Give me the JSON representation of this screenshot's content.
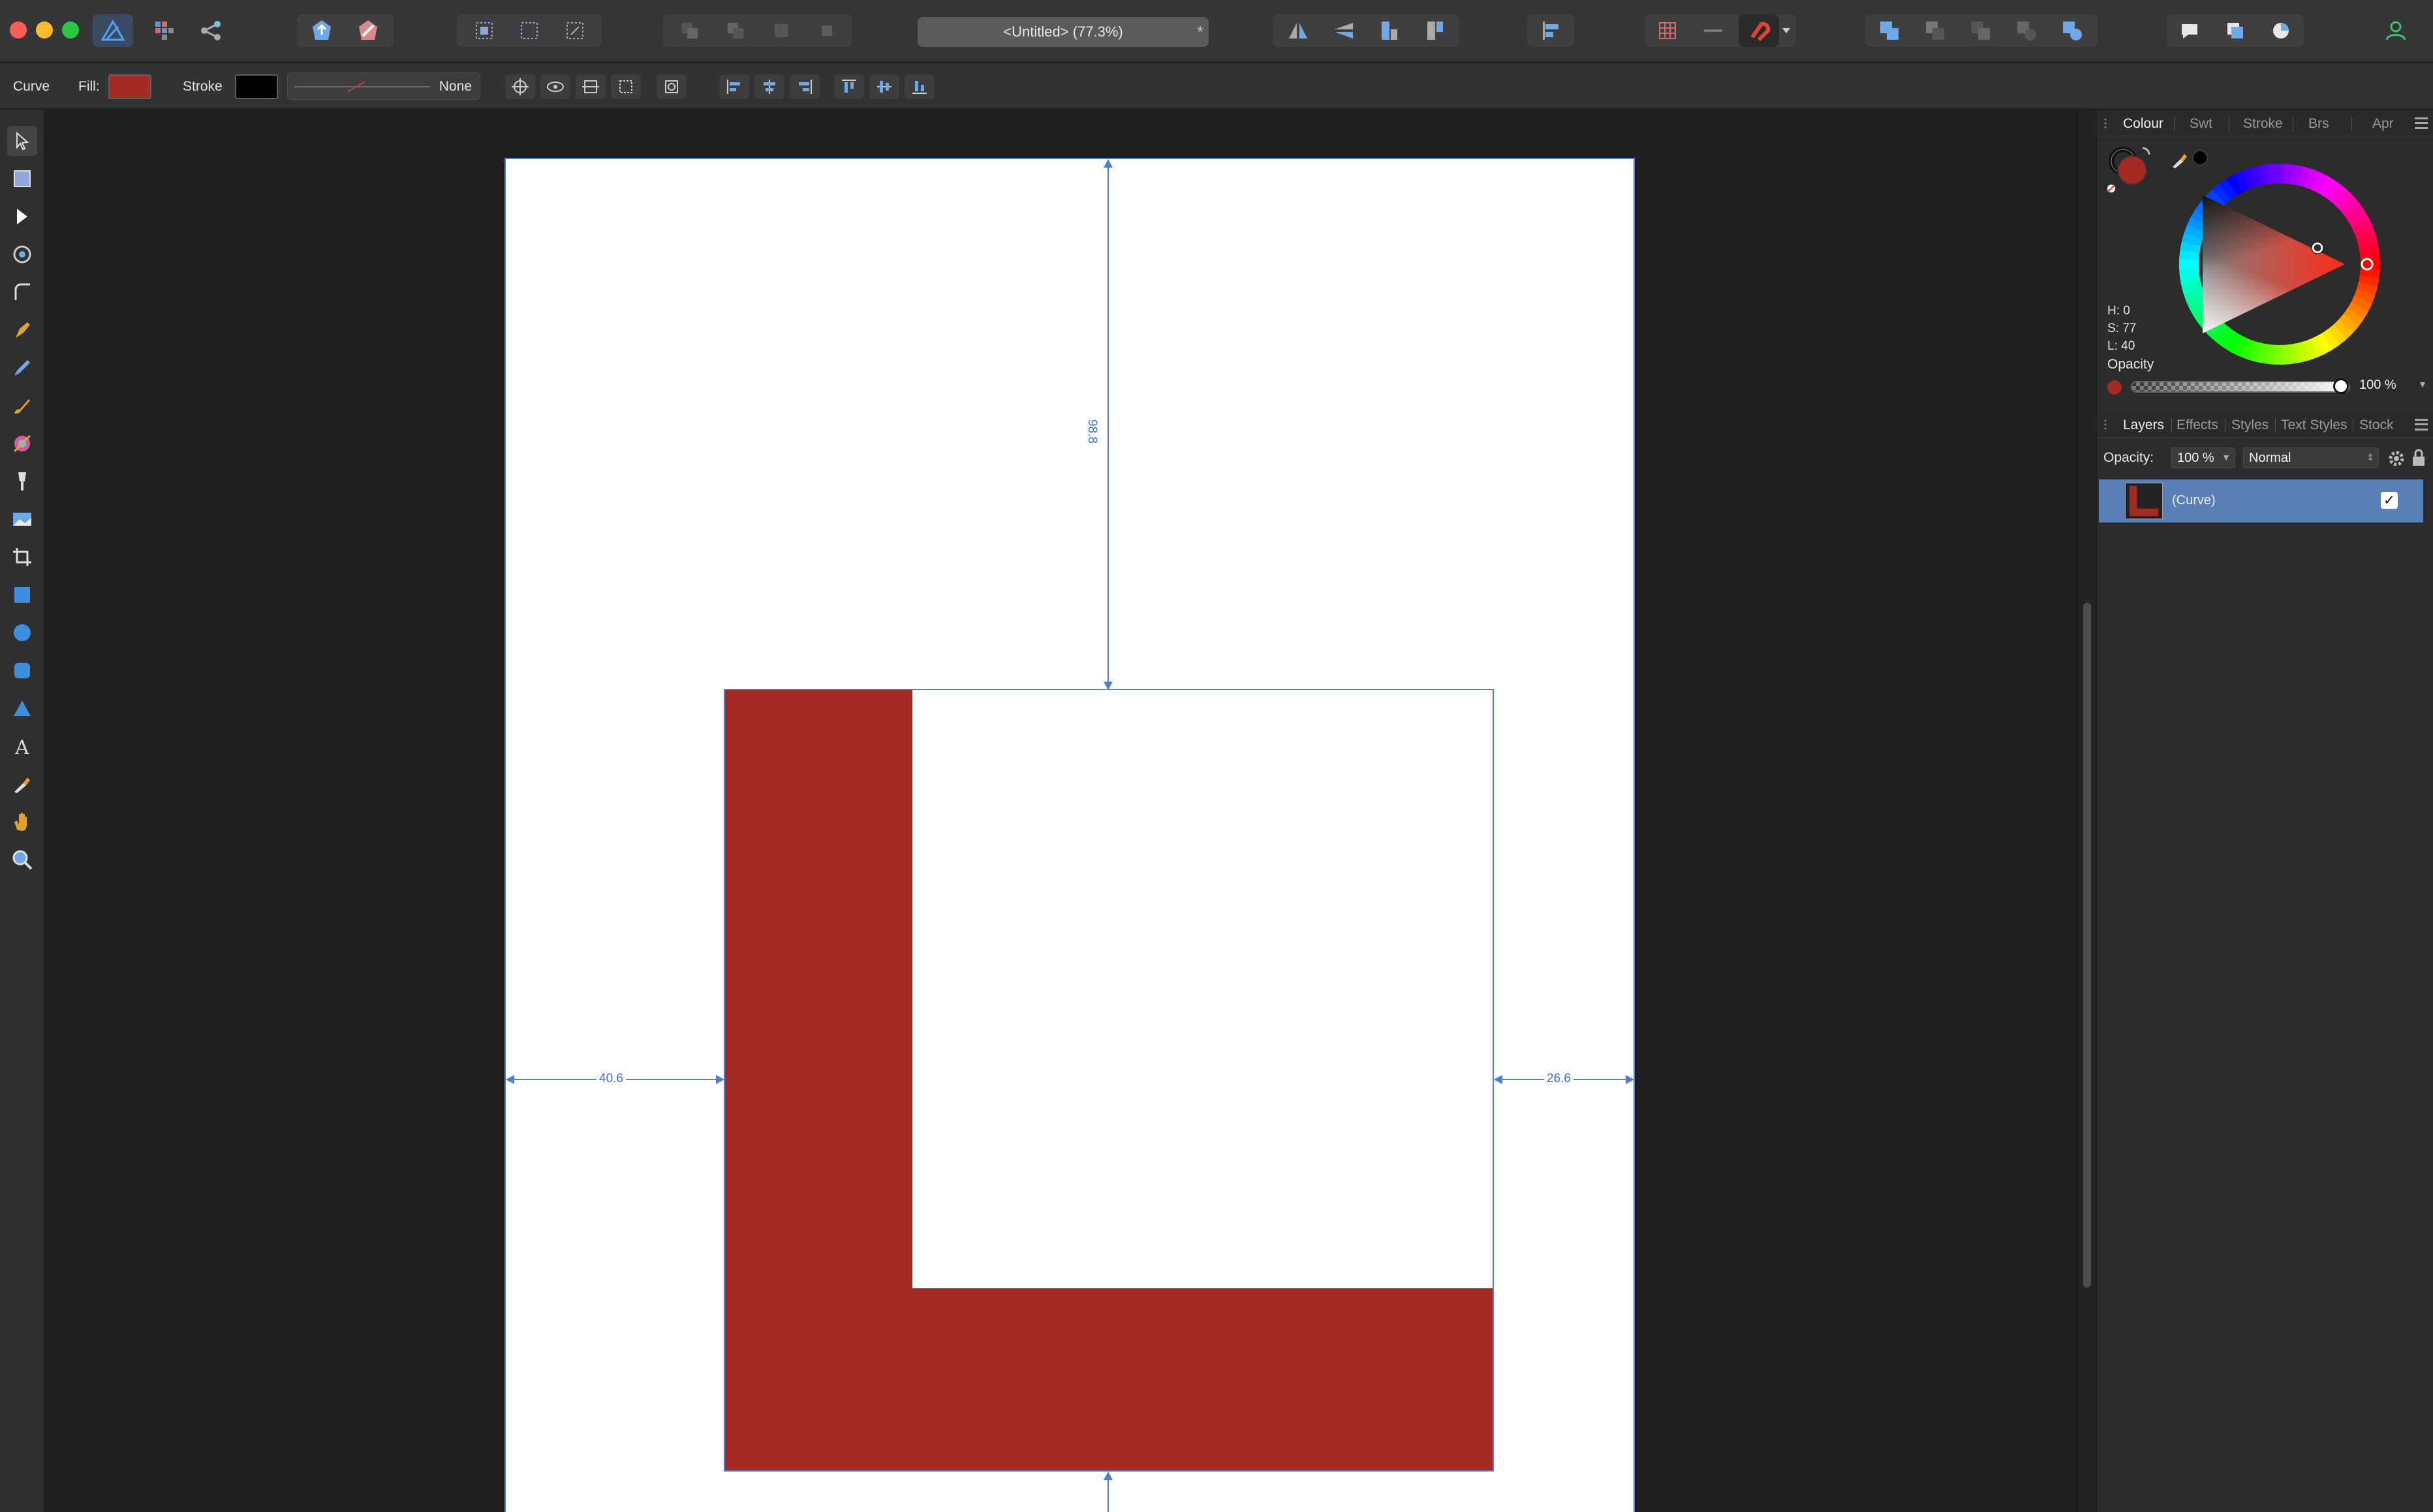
{
  "window": {
    "document_title": "<Untitled> (77.3%)",
    "modified_marker": "*"
  },
  "context_toolbar": {
    "tool_name": "Curve",
    "fill_label": "Fill:",
    "fill_color": "#a52a24",
    "stroke_label": "Stroke",
    "stroke_color": "#000000",
    "stroke_width_value": "None"
  },
  "canvas": {
    "shape_fill": "#a52a24",
    "dimension_top": "98.8",
    "dimension_left": "40.6",
    "dimension_right": "26.6"
  },
  "colour_panel": {
    "tabs": [
      "Colour",
      "Swt",
      "Stroke",
      "Brs",
      "Apr"
    ],
    "active_tab": "Colour",
    "hue": "H: 0",
    "saturation": "S: 77",
    "lightness": "L: 40",
    "opacity_label": "Opacity",
    "opacity_value": "100 %",
    "opacity_fraction": 1.0
  },
  "layers_panel": {
    "tabs": [
      "Layers",
      "Effects",
      "Styles",
      "Text Styles",
      "Stock"
    ],
    "active_tab": "Layers",
    "opacity_label": "Opacity:",
    "opacity_value": "100 %",
    "blend_mode": "Normal",
    "layers": [
      {
        "name": "(Curve)",
        "visible_check": "✓"
      }
    ]
  },
  "icons": {
    "toolbar": [
      "app-logo-icon",
      "pixel-persona-icon",
      "export-persona-icon",
      "assistant-icon",
      "snapping-options-icon",
      "arrange-icon",
      "flip-horizontal-icon",
      "flip-vertical-icon",
      "align-icon",
      "grid-icon",
      "snapping-magnet-icon",
      "boolean-icon",
      "view-icon",
      "account-icon"
    ],
    "tools": [
      "move-tool-icon",
      "artboard-tool-icon",
      "node-tool-icon",
      "corner-tool-icon",
      "point-transform-icon",
      "pen-tool-icon",
      "pencil-tool-icon",
      "vector-brush-icon",
      "fill-tool-icon",
      "transparency-tool-icon",
      "place-image-icon",
      "crop-tool-icon",
      "rectangle-tool-icon",
      "ellipse-tool-icon",
      "rounded-rect-tool-icon",
      "triangle-tool-icon",
      "text-tool-icon",
      "color-picker-icon",
      "hand-tool-icon",
      "zoom-tool-icon"
    ]
  }
}
